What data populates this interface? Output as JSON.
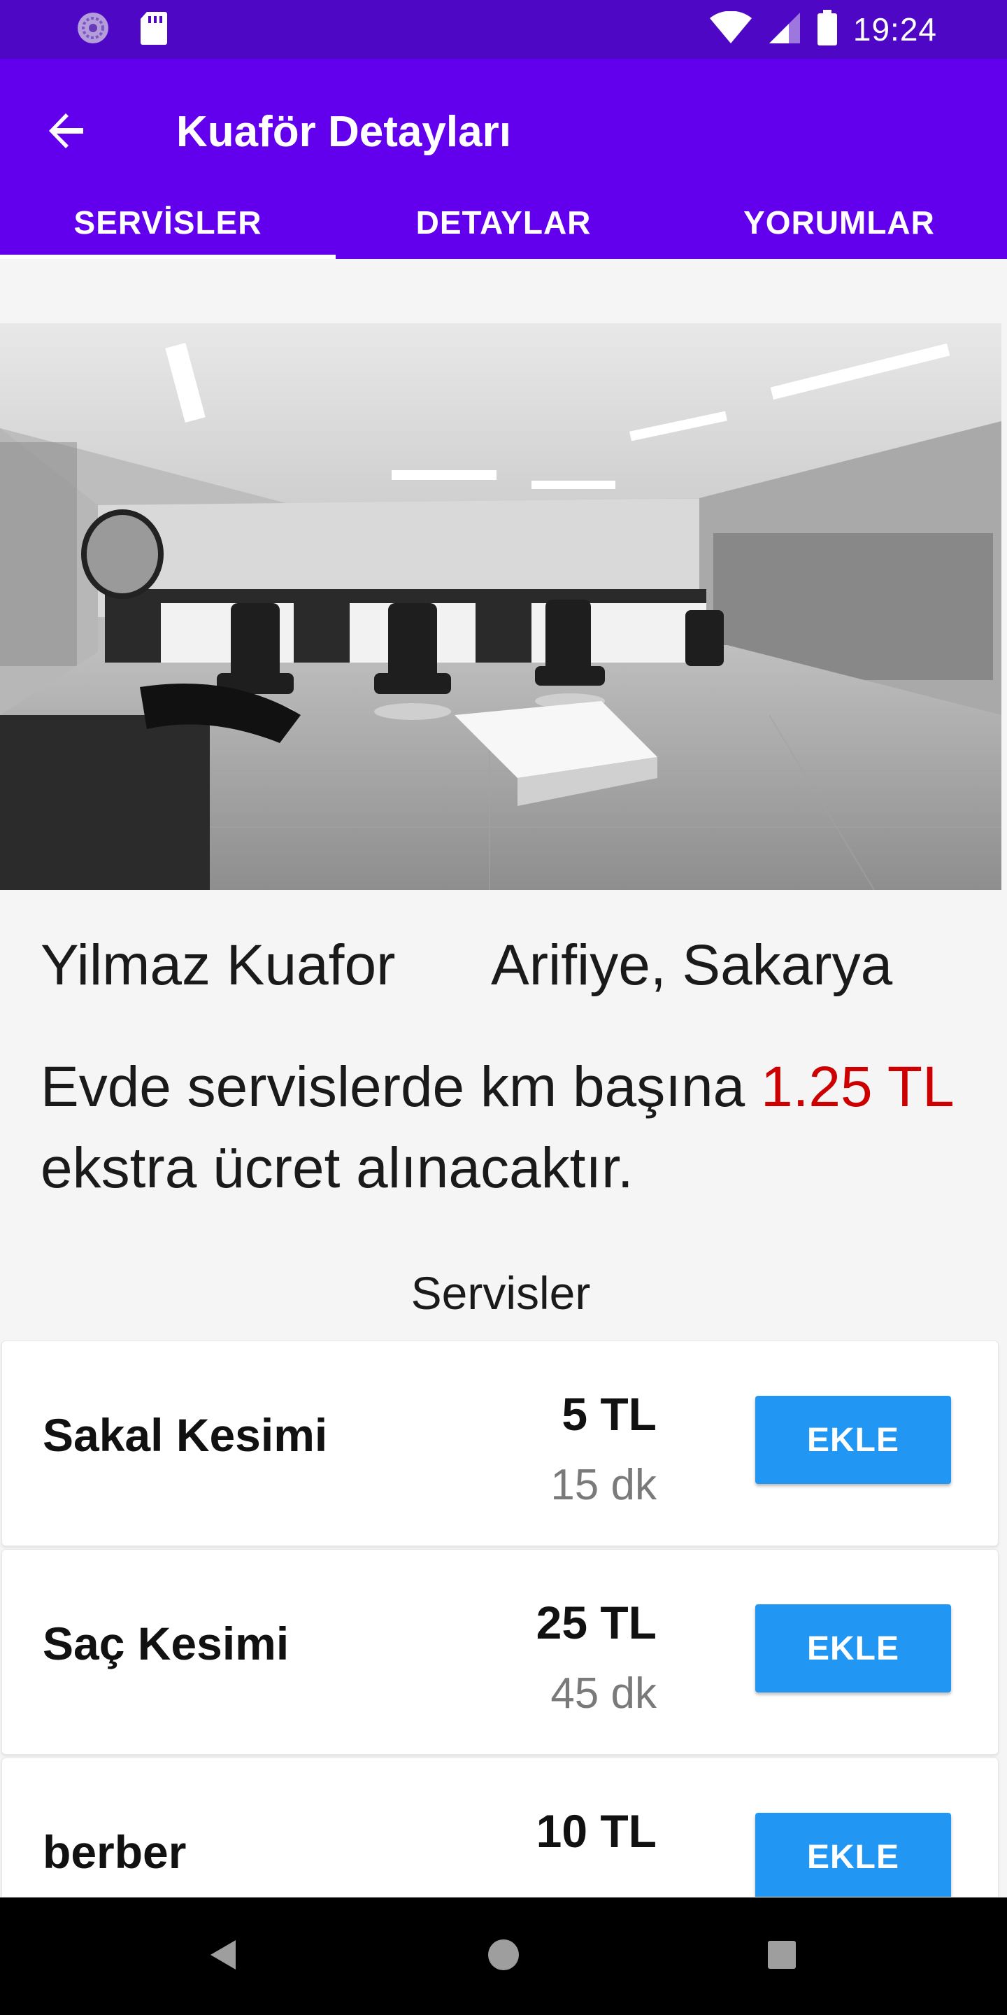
{
  "status_bar": {
    "time": "19:24",
    "icons": [
      "app-notification-icon",
      "sd-card-icon",
      "wifi-icon",
      "signal-icon",
      "battery-icon"
    ]
  },
  "app_bar": {
    "title": "Kuaför Detayları",
    "back_icon": "arrow-back-icon",
    "background_color": "#6200ee"
  },
  "tabs": [
    {
      "label": "SERVİSLER",
      "selected": true
    },
    {
      "label": "DETAYLAR",
      "selected": false
    },
    {
      "label": "YORUMLAR",
      "selected": false
    }
  ],
  "shop": {
    "name": "Yilmaz Kuafor",
    "location": "Arifiye, Sakarya"
  },
  "notice": {
    "before": "Evde servislerde km başına ",
    "price": "1.25 TL",
    "after": " ekstra ücret alınacaktır.",
    "price_color": "#cc0000"
  },
  "services_section": {
    "title": "Servisler",
    "items": [
      {
        "name": "Sakal Kesimi",
        "price": "5 TL",
        "duration": "15 dk",
        "button": "EKLE"
      },
      {
        "name": "Saç Kesimi",
        "price": "25 TL",
        "duration": "45 dk",
        "button": "EKLE"
      },
      {
        "name": "berber",
        "price": "10 TL",
        "duration": "",
        "button": "EKLE"
      }
    ],
    "button_color": "#2196f3"
  },
  "nav_bar": {
    "icons": [
      "back-triangle-icon",
      "home-circle-icon",
      "recents-square-icon"
    ]
  }
}
